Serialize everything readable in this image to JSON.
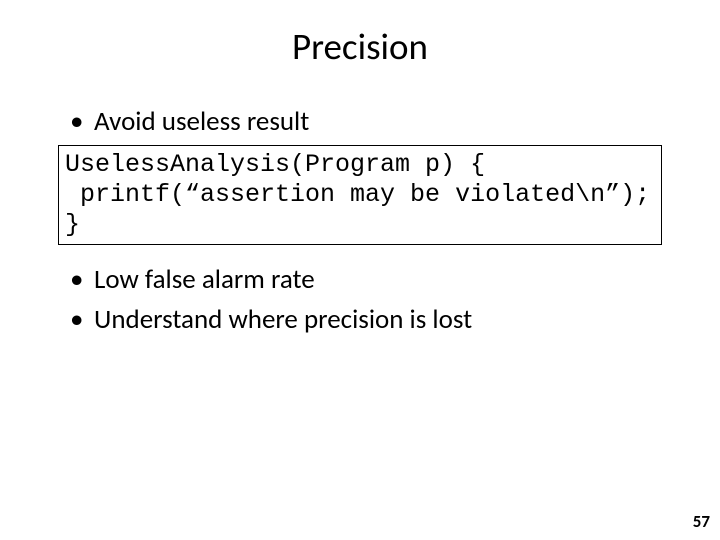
{
  "title": "Precision",
  "bullets_top": [
    "Avoid useless result"
  ],
  "code": "UselessAnalysis(Program p) {\n printf(“assertion may be violated\\n”);\n}",
  "bullets_bottom": [
    "Low false alarm rate",
    "Understand where precision is lost"
  ],
  "page_number": "57"
}
